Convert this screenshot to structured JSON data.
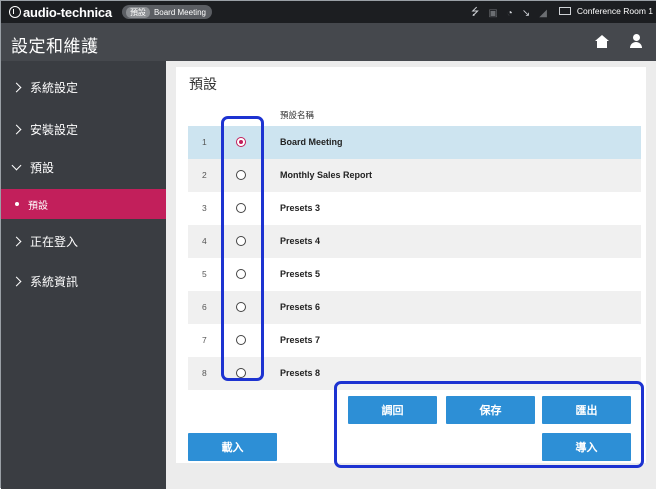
{
  "topbar": {
    "brand": "audio-technica",
    "preset_key": "預設",
    "preset_value": "Board Meeting",
    "room": "Conference Room 1"
  },
  "titlebar": {
    "title": "設定和維護"
  },
  "sidebar": {
    "items": [
      {
        "label": "系統設定"
      },
      {
        "label": "安裝設定"
      },
      {
        "label": "預設"
      },
      {
        "label": "預設"
      },
      {
        "label": "正在登入"
      },
      {
        "label": "系統資訊"
      }
    ]
  },
  "main": {
    "title": "預設",
    "table": {
      "header_name": "預設名稱",
      "rows": [
        {
          "num": "1",
          "name": "Board Meeting"
        },
        {
          "num": "2",
          "name": "Monthly Sales Report"
        },
        {
          "num": "3",
          "name": "Presets 3"
        },
        {
          "num": "4",
          "name": "Presets 4"
        },
        {
          "num": "5",
          "name": "Presets 5"
        },
        {
          "num": "6",
          "name": "Presets 6"
        },
        {
          "num": "7",
          "name": "Presets 7"
        },
        {
          "num": "8",
          "name": "Presets 8"
        }
      ],
      "selected_index": 0
    },
    "buttons": {
      "load": "載入",
      "recall": "調回",
      "save": "保存",
      "export": "匯出",
      "import": "導入"
    }
  },
  "colors": {
    "accent": "#c21f5b",
    "button": "#2d8fd6",
    "highlight": "#1d33d1",
    "selected_row": "#cde4f0"
  }
}
